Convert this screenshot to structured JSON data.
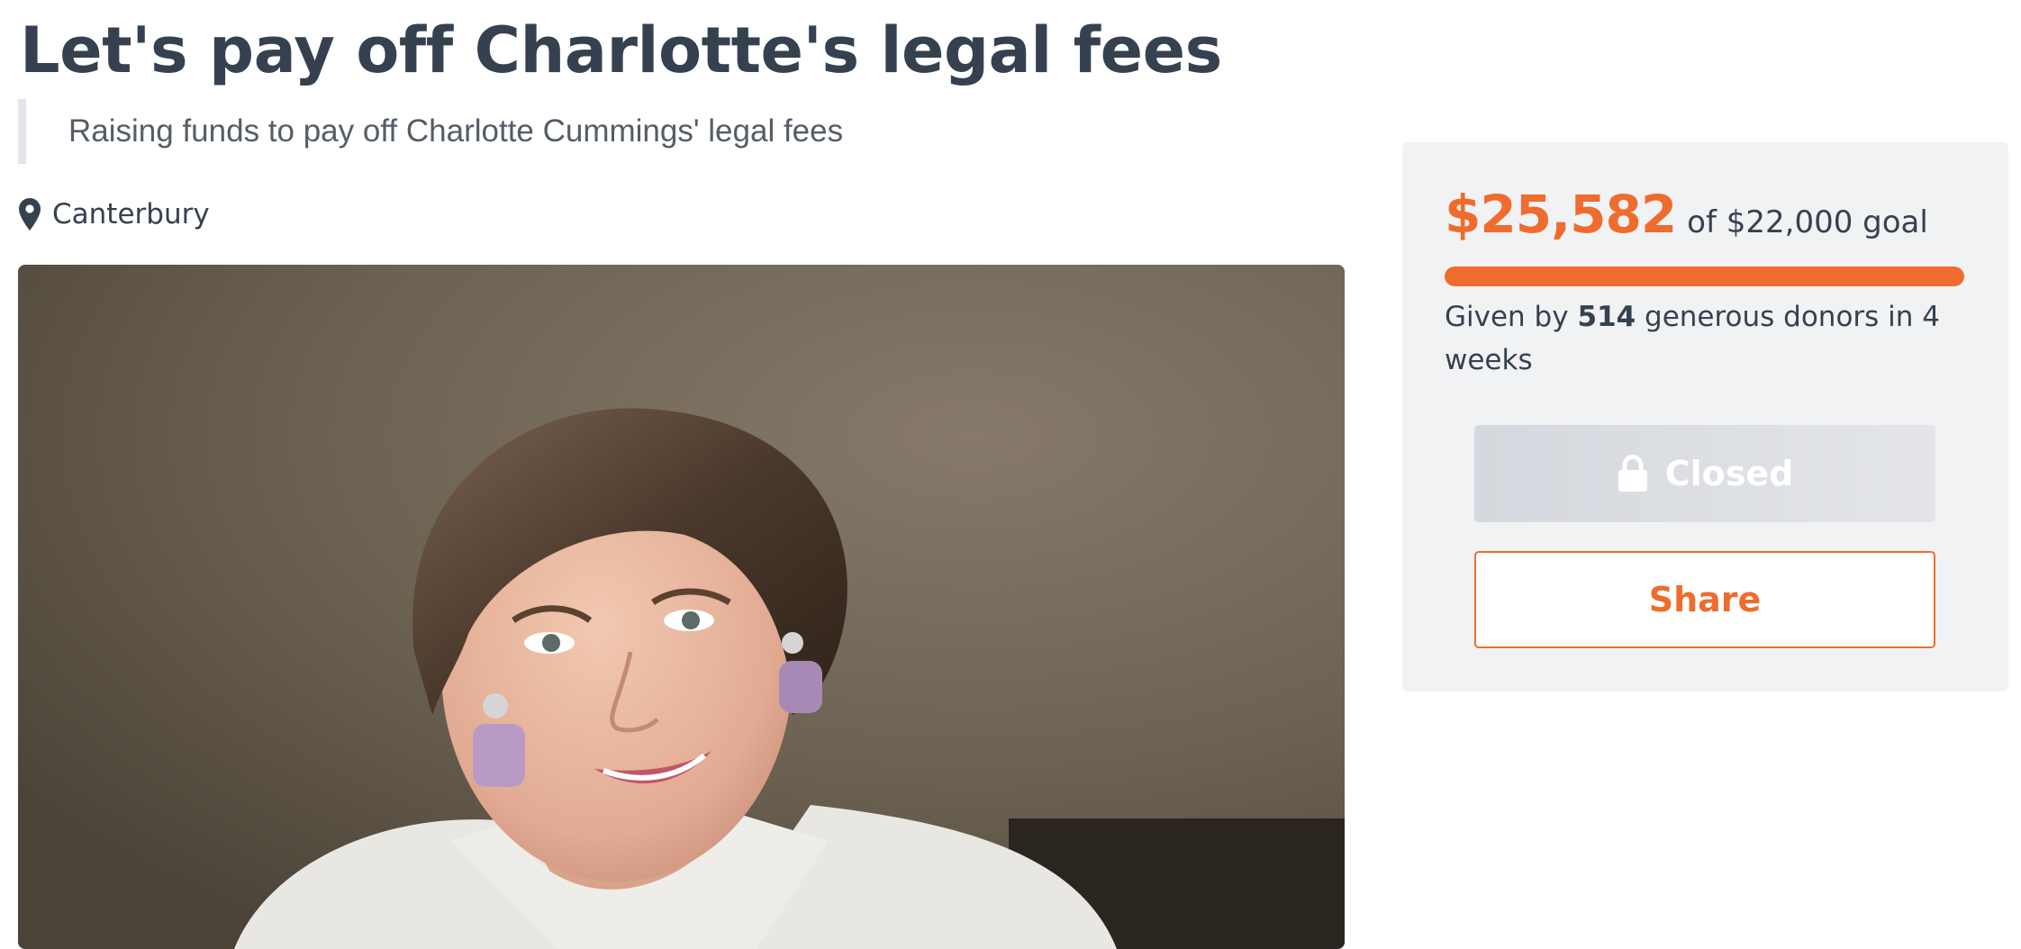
{
  "campaign": {
    "title": "Let's pay off Charlotte's legal fees",
    "summary": "Raising funds to pay off Charlotte Cummings' legal fees",
    "location": "Canterbury"
  },
  "funding": {
    "raised": "$25,582",
    "goal_text": "of $22,000 goal",
    "progress_percent": 100,
    "donors_prefix": "Given by",
    "donor_count": "514",
    "donors_suffix": "generous donors in 4 weeks"
  },
  "actions": {
    "closed_label": "Closed",
    "share_label": "Share"
  },
  "icons": {
    "location": "map-pin-icon",
    "closed": "lock-icon"
  },
  "colors": {
    "accent": "#ef6c2d",
    "text": "#364150",
    "panel": "#f1f2f4",
    "disabled_button": "#dcdfe4"
  }
}
